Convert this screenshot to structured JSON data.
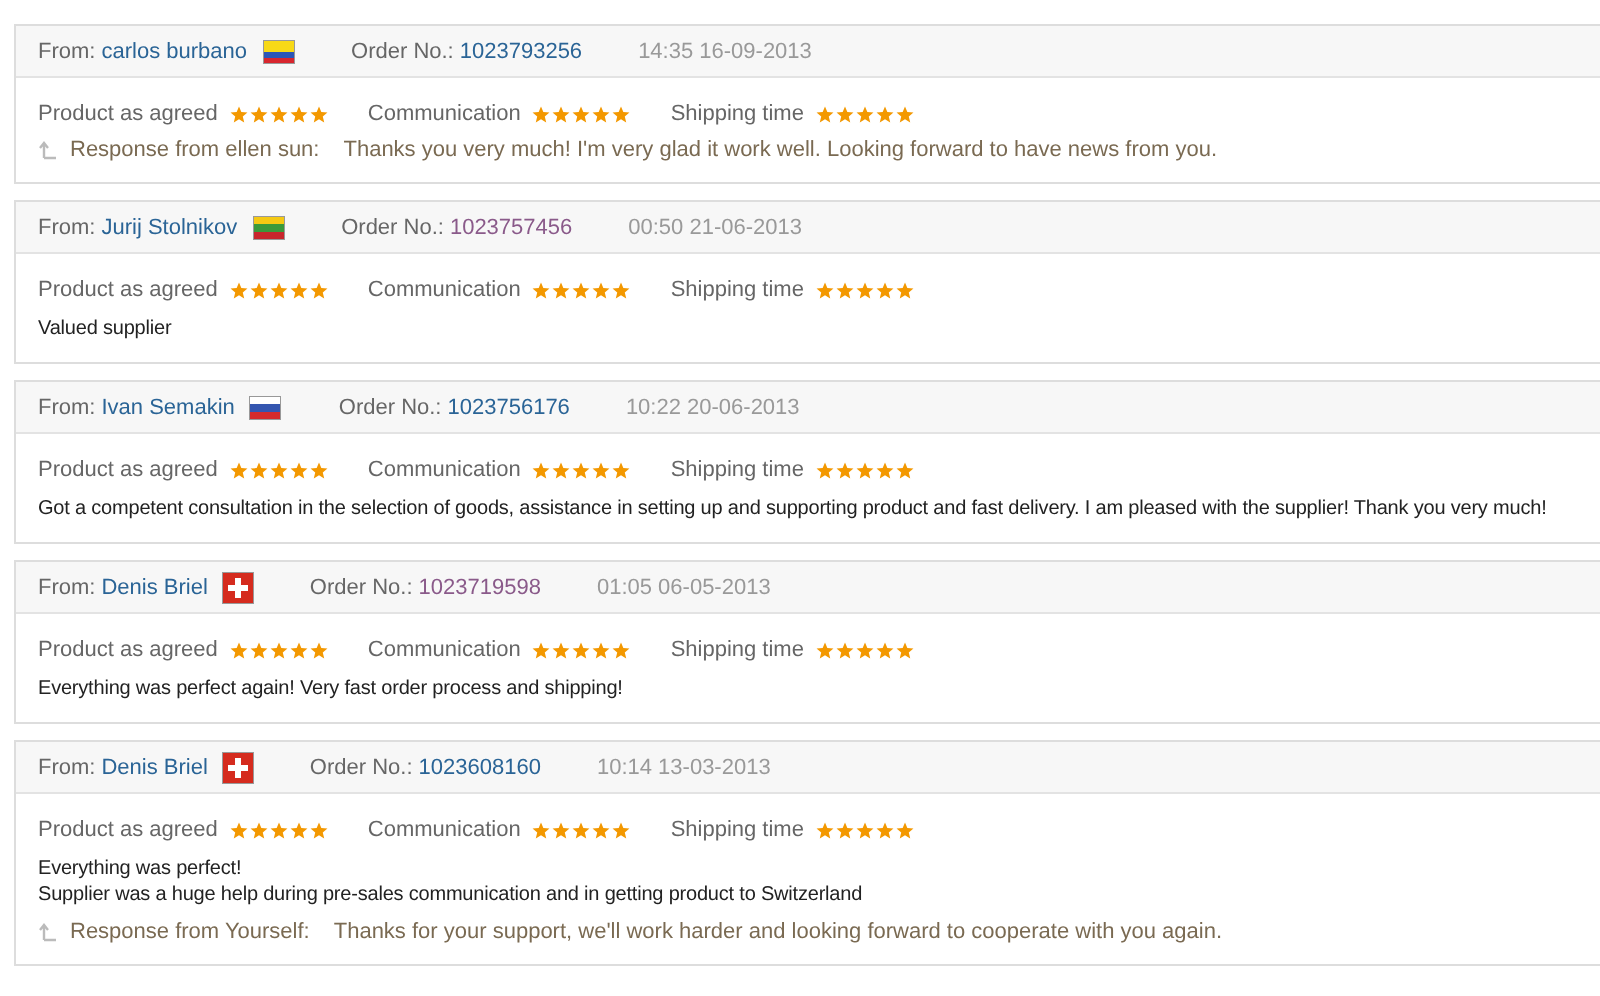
{
  "reviews": [
    {
      "from_label": "From:",
      "name": "carlos burbano",
      "kind": "colombia",
      "order_label": "Order No.:",
      "order_no": "1023793256",
      "visited": false,
      "time": "14:35 16-09-2013",
      "ratings": [
        {
          "label": "Product as agreed",
          "stars": 5
        },
        {
          "label": "Communication",
          "stars": 5
        },
        {
          "label": "Shipping time",
          "stars": 5
        }
      ],
      "response": {
        "label": "Response from ellen sun:",
        "text": "Thanks you very much! I'm very glad it work well. Looking forward to have news from you."
      }
    },
    {
      "from_label": "From:",
      "name": "Jurij Stolnikov",
      "kind": "lithuania",
      "order_label": "Order No.:",
      "order_no": "1023757456",
      "visited": true,
      "time": "00:50 21-06-2013",
      "ratings": [
        {
          "label": "Product as agreed",
          "stars": 5
        },
        {
          "label": "Communication",
          "stars": 5
        },
        {
          "label": "Shipping time",
          "stars": 5
        }
      ],
      "comment": [
        "Valued supplier"
      ]
    },
    {
      "from_label": "From:",
      "name": "Ivan Semakin",
      "kind": "russia",
      "order_label": "Order No.:",
      "order_no": "1023756176",
      "visited": false,
      "time": "10:22 20-06-2013",
      "ratings": [
        {
          "label": "Product as agreed",
          "stars": 5
        },
        {
          "label": "Communication",
          "stars": 5
        },
        {
          "label": "Shipping time",
          "stars": 5
        }
      ],
      "comment": [
        "Got a competent consultation in the selection of goods, assistance in setting up and supporting product and fast delivery. I am pleased with the supplier! Thank you very much!"
      ]
    },
    {
      "from_label": "From:",
      "name": "Denis Briel",
      "kind": "switzerland",
      "order_label": "Order No.:",
      "order_no": "1023719598",
      "visited": true,
      "time": "01:05 06-05-2013",
      "ratings": [
        {
          "label": "Product as agreed",
          "stars": 5
        },
        {
          "label": "Communication",
          "stars": 5
        },
        {
          "label": "Shipping time",
          "stars": 5
        }
      ],
      "comment": [
        "Everything was perfect again! Very fast order process and shipping!"
      ]
    },
    {
      "from_label": "From:",
      "name": "Denis Briel",
      "kind": "switzerland",
      "order_label": "Order No.:",
      "order_no": "1023608160",
      "visited": false,
      "time": "10:14 13-03-2013",
      "ratings": [
        {
          "label": "Product as agreed",
          "stars": 5
        },
        {
          "label": "Communication",
          "stars": 5
        },
        {
          "label": "Shipping time",
          "stars": 5
        }
      ],
      "comment": [
        "Everything was perfect!",
        "Supplier was a huge help during pre-sales communication and in getting product to Switzerland"
      ],
      "response": {
        "label": "Response from Yourself:",
        "text": "Thanks for your support, we'll work harder and looking forward to cooperate with you again."
      }
    }
  ]
}
